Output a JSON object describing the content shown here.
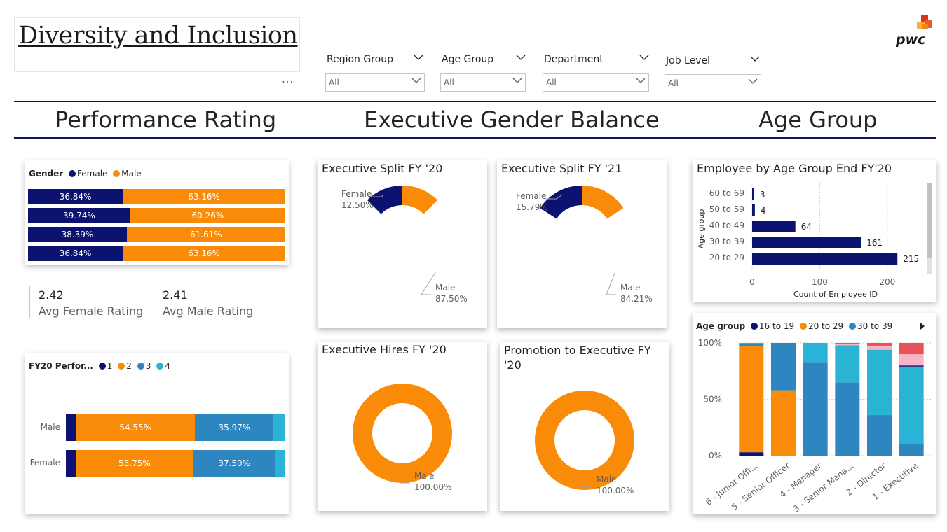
{
  "header": {
    "title": "Diversity and Inclusion",
    "more_options": "..."
  },
  "brand": {
    "logo_text": "pwc"
  },
  "filters": [
    {
      "label": "Region Group",
      "value": "All"
    },
    {
      "label": "Age Group",
      "value": "All"
    },
    {
      "label": "Department",
      "value": "All"
    },
    {
      "label": "Job Level",
      "value": "All"
    }
  ],
  "sections": {
    "performance": "Performance Rating",
    "gender_balance": "Executive Gender Balance",
    "age_group": "Age Group"
  },
  "colors": {
    "navy": "#0b1270",
    "orange": "#f98b08",
    "blue": "#2e86c1",
    "teal": "#2bb3d6",
    "pink": "#f7b6c2",
    "red": "#e8525b",
    "rule": "#0f1957"
  },
  "gender_rating": {
    "legend_title": "Gender",
    "legend": [
      "Female",
      "Male"
    ],
    "rows": [
      {
        "female": 36.84,
        "male": 63.16,
        "female_label": "36.84%",
        "male_label": "63.16%"
      },
      {
        "female": 39.74,
        "male": 60.26,
        "female_label": "39.74%",
        "male_label": "60.26%"
      },
      {
        "female": 38.39,
        "male": 61.61,
        "female_label": "38.39%",
        "male_label": "61.61%"
      },
      {
        "female": 36.84,
        "male": 63.16,
        "female_label": "36.84%",
        "male_label": "63.16%"
      }
    ]
  },
  "kpis": [
    {
      "value": "2.42",
      "label": "Avg Female Rating"
    },
    {
      "value": "2.41",
      "label": "Avg Male Rating"
    }
  ],
  "fy20_performance": {
    "legend_title": "FY20 Perfor...",
    "legend": [
      "1",
      "2",
      "3",
      "4"
    ],
    "rows": [
      {
        "name": "Male",
        "values": [
          4.5,
          54.55,
          35.97,
          4.98
        ],
        "labels": [
          "",
          "54.55%",
          "35.97%",
          ""
        ]
      },
      {
        "name": "Female",
        "values": [
          4.5,
          53.75,
          37.5,
          4.25
        ],
        "labels": [
          "",
          "53.75%",
          "37.50%",
          ""
        ]
      }
    ]
  },
  "donuts": [
    {
      "title": "Executive Split FY '20",
      "female": 12.5,
      "male": 87.5,
      "female_name": "Female",
      "female_label": "12.50%",
      "male_name": "Male",
      "male_label": "87.50%"
    },
    {
      "title": "Executive Split FY '21",
      "female": 15.79,
      "male": 84.21,
      "female_name": "Female",
      "female_label": "15.79%",
      "male_name": "Male",
      "male_label": "84.21%"
    },
    {
      "title": "Executive Hires FY '20",
      "female": 0,
      "male": 100,
      "female_name": "",
      "female_label": "",
      "male_name": "Male",
      "male_label": "100.00%"
    },
    {
      "title": "Promotion to Executive FY '20",
      "female": 0,
      "male": 100,
      "female_name": "",
      "female_label": "",
      "male_name": "Male",
      "male_label": "100.00%"
    }
  ],
  "chart_data": [
    {
      "type": "bar",
      "title": "Employee by Age Group End FY'20",
      "xlabel": "Count of Employee ID",
      "ylabel": "Age group",
      "categories": [
        "60 to 69",
        "50 to 59",
        "40 to 49",
        "30 to 39",
        "20 to 29"
      ],
      "values": [
        3,
        4,
        64,
        161,
        215
      ],
      "xlim": [
        0,
        250
      ],
      "xticks": [
        "0",
        "100",
        "200"
      ],
      "grid": true
    },
    {
      "type": "bar",
      "stacked": "100%",
      "legend_title": "Age group",
      "legend": [
        "16 to 19",
        "20 to 29",
        "30 to 39"
      ],
      "categories": [
        "6 - Junior Offi...",
        "5 - Senior Officer",
        "4 - Manager",
        "3 - Senior Mana...",
        "2 - Director",
        "1 - Executive"
      ],
      "yticks": [
        "100%",
        "50%",
        "0%"
      ],
      "series": [
        {
          "name": "16 to 19",
          "color": "#0b1270",
          "values": [
            3,
            0,
            0,
            0,
            0,
            0
          ]
        },
        {
          "name": "20 to 29",
          "color": "#f98b08",
          "values": [
            94,
            58,
            0,
            0,
            0,
            0
          ]
        },
        {
          "name": "30 to 39",
          "color": "#2e86c1",
          "values": [
            2,
            42,
            83,
            65,
            36,
            10
          ]
        },
        {
          "color": "#2bb3d6",
          "values": [
            1,
            0,
            17,
            33,
            58,
            69
          ]
        },
        {
          "color": "#0b1270",
          "values": [
            0,
            0,
            0,
            0,
            0,
            1
          ]
        },
        {
          "color": "#f7b6c2",
          "values": [
            0,
            0,
            0,
            1,
            3,
            10
          ]
        },
        {
          "color": "#e8525b",
          "values": [
            0,
            0,
            0,
            1,
            3,
            10
          ]
        }
      ]
    }
  ]
}
